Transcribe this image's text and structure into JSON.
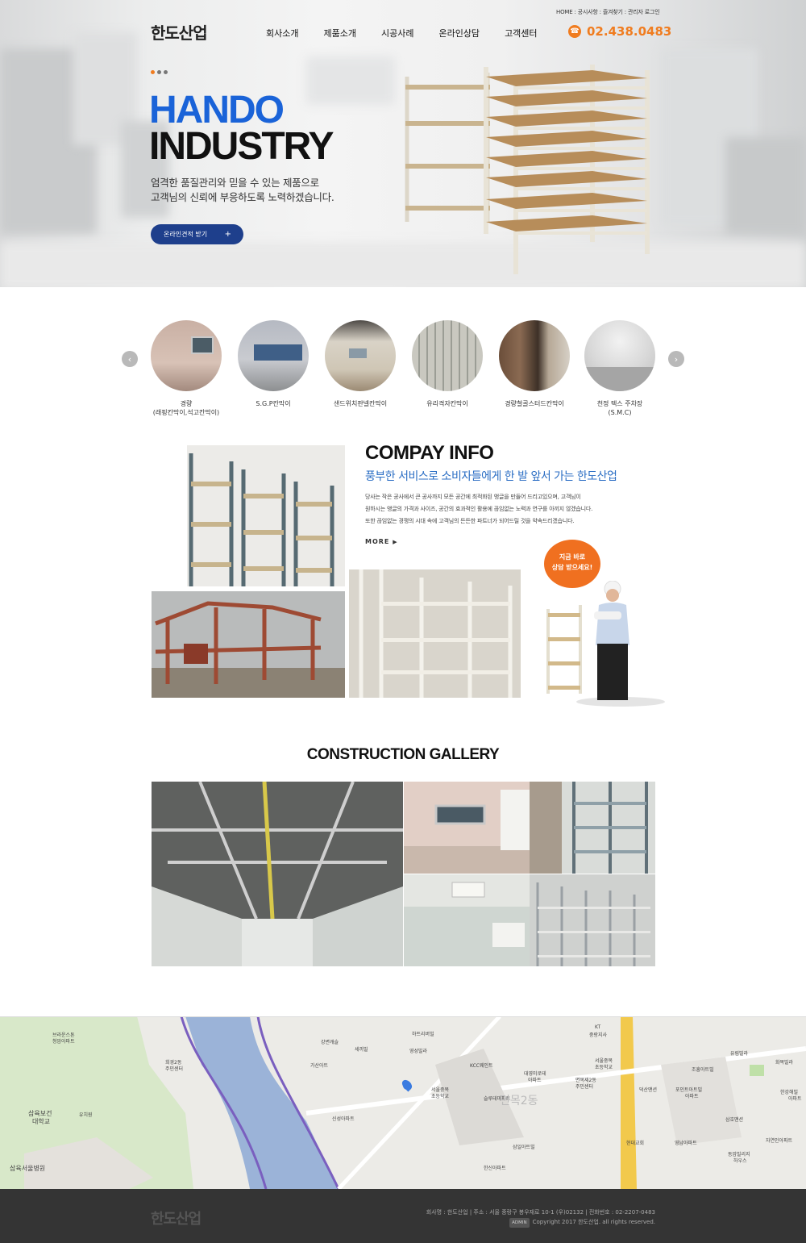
{
  "header": {
    "util_links": "HOME : 공시사항 : 즐겨찾기 : 관리자 로그인",
    "logo": "한도산업",
    "nav": [
      "회사소개",
      "제품소개",
      "시공사례",
      "온라인상담",
      "고객센터"
    ],
    "phone_icon": "phone-icon",
    "phone": "02.438.0483"
  },
  "hero": {
    "title_line1": "HANDO",
    "title_line2": "INDUSTRY",
    "desc_line1": "엄격한 품질관리와 믿을 수 있는 제품으로",
    "desc_line2": "고객님의 신뢰에 부응하도록 노력하겠습니다.",
    "button_label": "온라인견적 받기",
    "button_icon": "+"
  },
  "categories": [
    {
      "label_line1": "경량",
      "label_line2": "(래핑칸막이,석고칸막이)"
    },
    {
      "label_line1": "S.G.P칸막이",
      "label_line2": ""
    },
    {
      "label_line1": "샌드위치판넬칸막이",
      "label_line2": ""
    },
    {
      "label_line1": "유리격자칸막이",
      "label_line2": ""
    },
    {
      "label_line1": "경량철골스터드칸막이",
      "label_line2": ""
    },
    {
      "label_line1": "천정 텍스 주차장",
      "label_line2": "(S.M.C)"
    }
  ],
  "company": {
    "title": "COMPAY INFO",
    "subtitle": "풍부한 서비스로 소비자들에게 한 발 앞서 가는 한도산업",
    "text_line1": "당사는 작은 공사에서 큰 공사까지 모든 공간에 최적화된 앵글을 만들어 드리고있으며, 고객님이",
    "text_line2": "원하시는 앵글의 가격과 사이즈, 공간의 효과적인 활용에 끊임없는 노력과 연구를 아끼지 않겠습니다.",
    "text_line3": "또한 끊임없는 경쟁의 시대 속에 고객님의 든든한 파트너가 되어드릴 것을 약속드리겠습니다.",
    "more": "MORE",
    "bubble_line1": "지금 바로",
    "bubble_line2": "상담 받으세요!"
  },
  "gallery": {
    "title": "CONSTRUCTION GALLERY"
  },
  "map": {
    "labels": [
      "브라운스톤",
      "청암아파트",
      "희경2동",
      "주민센터",
      "삼육보건",
      "대학교",
      "삼육서울병원",
      "유치원",
      "강변캐슬",
      "가산아트",
      "세끼빌",
      "하트리버빌",
      "영성빌라",
      "KCC웨인트",
      "대영미로테",
      "아파트",
      "면목제2동",
      "주민센터",
      "서울중목",
      "초등학교",
      "슬루테마파트",
      "신성아파트",
      "삼일아트빌",
      "한신아파트",
      "KT",
      "중랑지사",
      "서울중목",
      "초등학교",
      "덕산맨션",
      "조흥아트빌",
      "포인트아트빌",
      "아파트",
      "유림빌라",
      "화목빌라",
      "한강해빌",
      "아파트",
      "삼호맨션",
      "자연인아파트",
      "영남아파트",
      "동암빌리지",
      "하우스",
      "현대교회",
      "면목2동"
    ]
  },
  "footer": {
    "logo": "한도산업",
    "info": "회사명 : 한도산업 | 주소 : 서울 중랑구 봉우재로 10-1 (우)02132 | 전화번호 : 02-2207-0483",
    "admin": "ADMIN",
    "copyright": "Copyright 2017 한도산업. all rights reserved."
  },
  "colors": {
    "accent_orange": "#f07c1f",
    "hero_blue": "#1a63d8",
    "button_navy": "#1e3f8c",
    "subtitle_blue": "#2b6ec4",
    "footer_bg": "#343434"
  }
}
